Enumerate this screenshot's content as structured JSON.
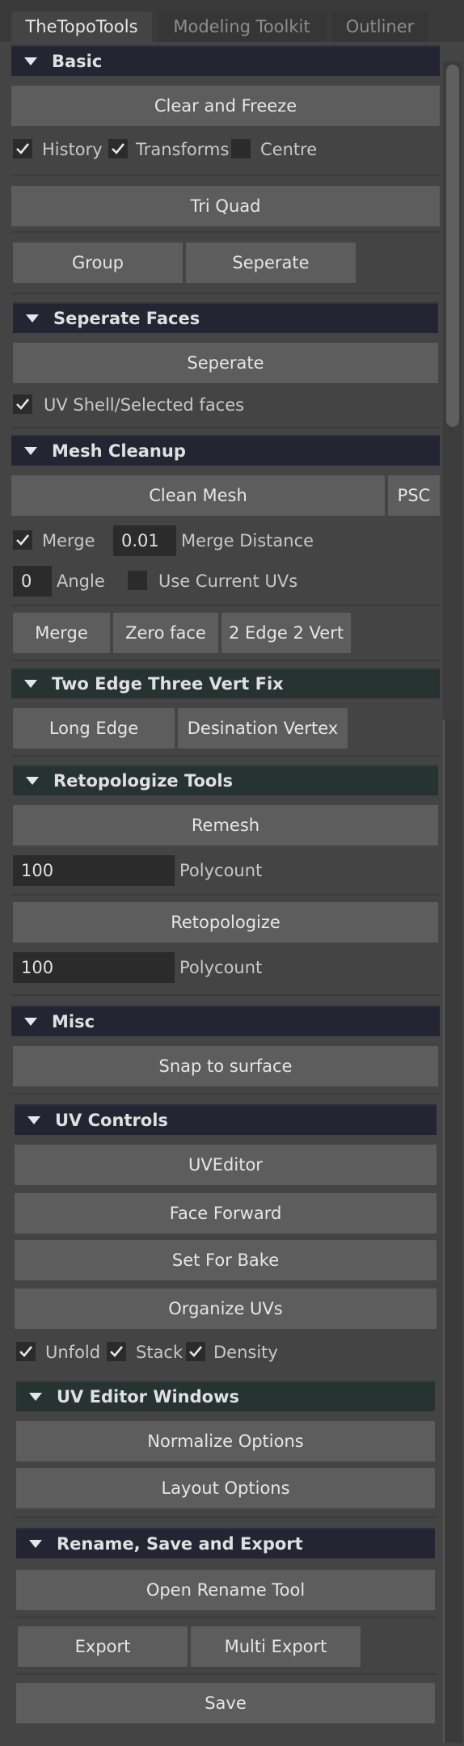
{
  "tabs": [
    {
      "label": "TheTopoTools",
      "active": true
    },
    {
      "label": "Modeling Toolkit",
      "active": false
    },
    {
      "label": "Outliner",
      "active": false
    }
  ],
  "basic": {
    "title": "Basic",
    "clear_freeze": "Clear and Freeze",
    "history": "History",
    "transforms": "Transforms",
    "centre": "Centre",
    "tri_quad": "Tri Quad",
    "group": "Group",
    "seperate": "Seperate"
  },
  "seperate_faces": {
    "title": "Seperate Faces",
    "seperate": "Seperate",
    "uv_shell": "UV Shell/Selected faces"
  },
  "mesh_cleanup": {
    "title": "Mesh Cleanup",
    "clean_mesh": "Clean Mesh",
    "psc": "PSC",
    "merge_check": "Merge",
    "merge_distance_value": "0.01",
    "merge_distance_label": "Merge Distance",
    "angle_value": "0",
    "angle_label": "Angle",
    "use_current_uvs": "Use Current UVs",
    "merge_btn": "Merge",
    "zero_face": "Zero face",
    "two_edge_two_vert": "2 Edge 2 Vert"
  },
  "two_edge_fix": {
    "title": "Two Edge Three Vert Fix",
    "long_edge": "Long Edge",
    "destination_vertex": "Desination Vertex"
  },
  "retopo": {
    "title": "Retopologize Tools",
    "remesh": "Remesh",
    "polycount_value_1": "100",
    "polycount_label_1": "Polycount",
    "retopologize": "Retopologize",
    "polycount_value_2": "100",
    "polycount_label_2": "Polycount"
  },
  "misc": {
    "title": "Misc",
    "snap": "Snap to surface"
  },
  "uv_controls": {
    "title": "UV Controls",
    "uveditor": "UVEditor",
    "face_forward": "Face Forward",
    "set_for_bake": "Set For Bake",
    "organize_uvs": "Organize UVs",
    "unfold": "Unfold",
    "stack": "Stack",
    "density": "Density"
  },
  "uv_editor_windows": {
    "title": "UV Editor Windows",
    "normalize": "Normalize Options",
    "layout": "Layout Options"
  },
  "rename": {
    "title": "Rename, Save and Export",
    "open_rename": "Open Rename Tool",
    "export": "Export",
    "multi_export": "Multi Export",
    "save": "Save"
  },
  "colors": {
    "background": "#444444",
    "button": "#5d5d5d",
    "section_header": "#242533",
    "section_header_alt": "#263330",
    "field": "#2b2b2b"
  }
}
